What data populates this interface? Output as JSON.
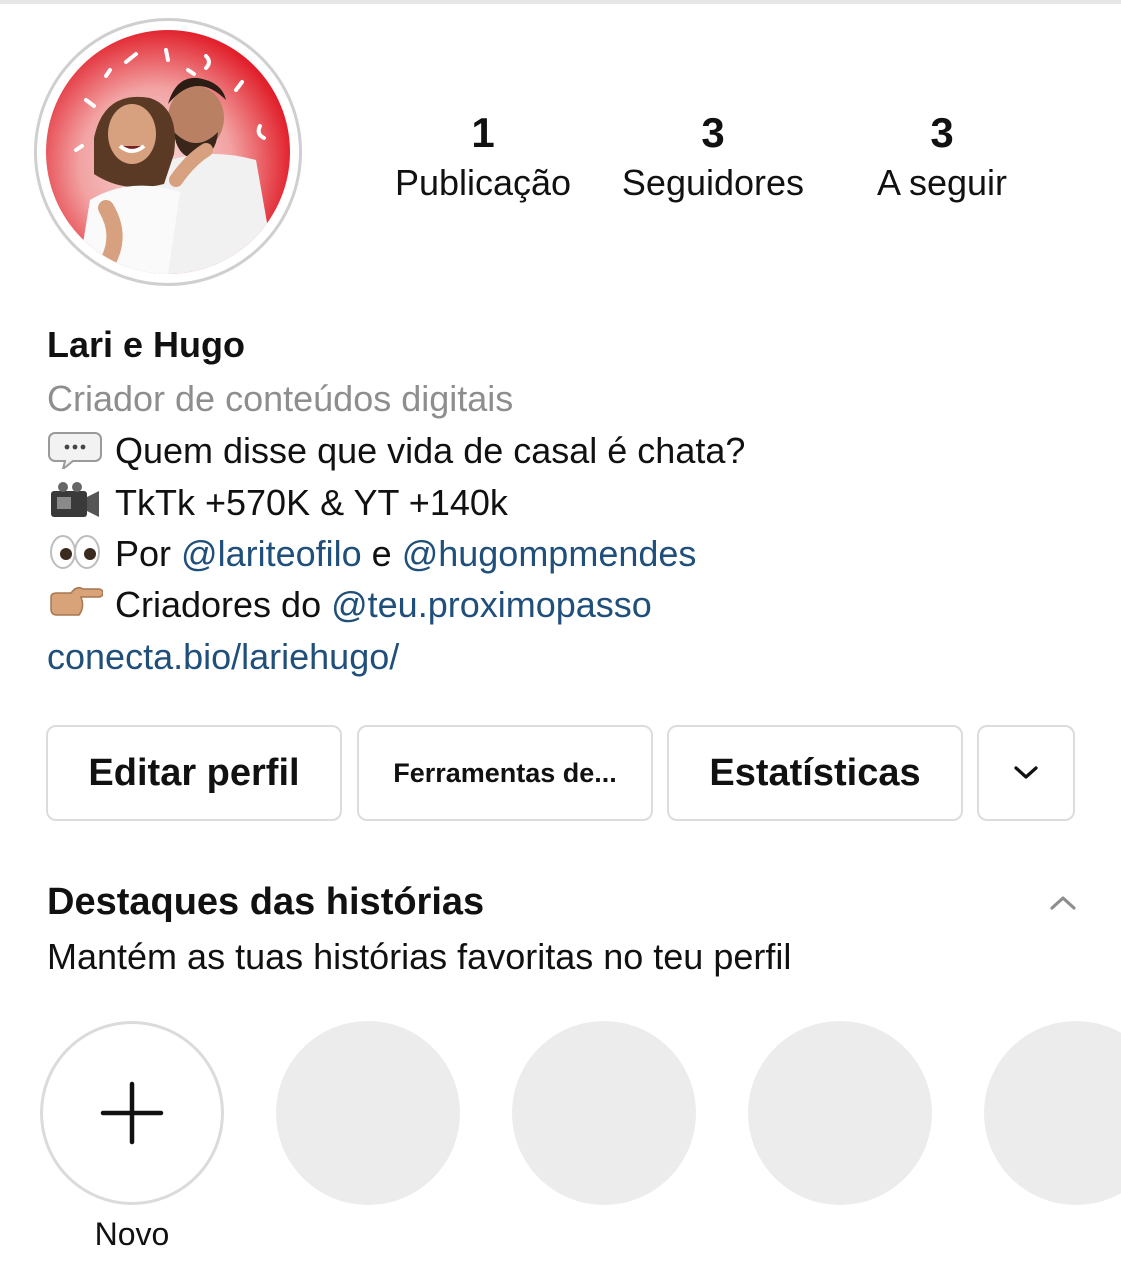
{
  "profile": {
    "display_name": "Lari e Hugo",
    "category": "Criador de conteúdos digitais",
    "bio_lines": [
      {
        "icon": "speech-bubble-icon",
        "text": "Quem disse que vida de casal é chata?"
      },
      {
        "icon": "video-camera-icon",
        "text": "TkTk +570K & YT +140k"
      },
      {
        "icon": "eyes-icon",
        "prefix": "Por ",
        "mention1": "@lariteofilo",
        "middle": " e ",
        "mention2": "@hugompmendes"
      },
      {
        "icon": "pointing-hand-icon",
        "prefix": "Criadores do ",
        "mention": "@teu.proximopasso"
      }
    ],
    "website": "conecta.bio/lariehugo/"
  },
  "stats": [
    {
      "count": "1",
      "label": "Publicação"
    },
    {
      "count": "3",
      "label": "Seguidores"
    },
    {
      "count": "3",
      "label": "A seguir"
    }
  ],
  "actions": {
    "edit_profile": "Editar perfil",
    "tools": "Ferramentas de...",
    "insights": "Estatísticas",
    "more_icon": "chevron-down-icon"
  },
  "highlights": {
    "title": "Destaques das histórias",
    "subtitle": "Mantém as tuas histórias favoritas no teu perfil",
    "toggle_icon": "chevron-up-icon",
    "new_label": "Novo",
    "new_icon": "plus-icon"
  },
  "colors": {
    "link": "#1f4f7a",
    "secondary_text": "#8e8e8e",
    "avatar_ring": "#e1202b",
    "placeholder": "#ececec"
  }
}
